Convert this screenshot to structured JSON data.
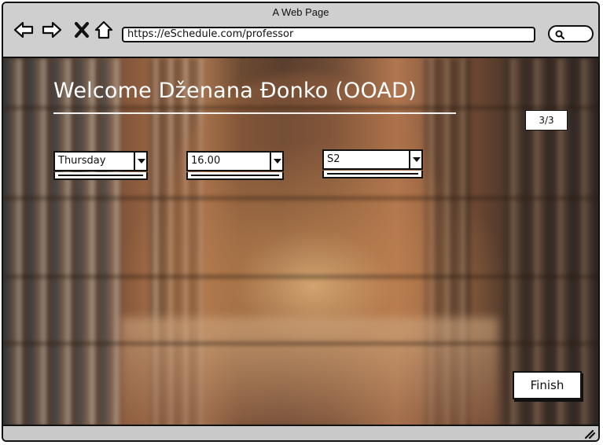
{
  "window": {
    "title": "A Web Page"
  },
  "browser": {
    "url": "https://eSchedule.com/professor",
    "icons": [
      "back-arrow-icon",
      "forward-arrow-icon",
      "close-icon",
      "home-icon",
      "search-icon"
    ]
  },
  "main": {
    "welcome": "Welcome Dženana Đonko (OOAD)",
    "page_counter": "3/3",
    "dropdowns": {
      "day": "Thursday",
      "time": "16.00",
      "room": "S2"
    },
    "finish_label": "Finish"
  },
  "colors": {
    "text_light": "#ffffff",
    "outline": "#111111",
    "chrome": "#c9c9c9"
  }
}
